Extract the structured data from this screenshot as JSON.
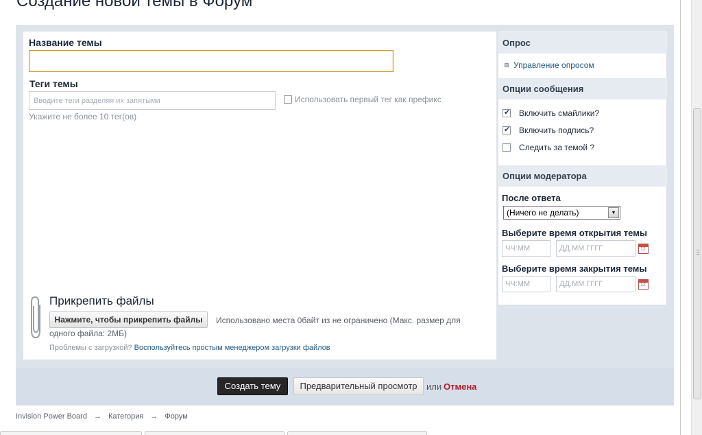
{
  "page": {
    "title": "Создание новой темы в Форум"
  },
  "topic": {
    "title_label": "Название темы",
    "title_value": "",
    "tags_label": "Теги темы",
    "tags_placeholder": "Вводите теги разделяя их запятыми",
    "prefix_label": "Использовать первый тег как префикс",
    "prefix_checked": false,
    "tags_hint": "Укажите не более 10 тег(ов)"
  },
  "attachments": {
    "title": "Прикрепить файлы",
    "button_label": "Нажмите, чтобы прикрепить файлы",
    "usage_text": "Использовано места 0байт из не ограничено (Макс. размер для одного файла: 2МБ)",
    "problem_text": "Проблемы с загрузкой?",
    "basic_uploader_link": "Воспользуйтесь простым менеджером загрузки файлов"
  },
  "sidebar": {
    "poll": {
      "header": "Опрос",
      "manage_link": "Управление опросом"
    },
    "post_options": {
      "header": "Опции сообщения",
      "items": [
        {
          "label": "Включить смайлики?",
          "checked": true
        },
        {
          "label": "Включить подпись?",
          "checked": true
        },
        {
          "label": "Следить за темой ?",
          "checked": false
        }
      ]
    },
    "moderator_options": {
      "header": "Опции модератора",
      "after_reply_label": "После ответа",
      "after_reply_value": "(Ничего не делать)",
      "open_time_label": "Выберите время открытия темы",
      "close_time_label": "Выберите время закрытия темы",
      "time_placeholder": "ЧЧ:ММ",
      "date_placeholder": "ДД.ММ.ГГГГ",
      "calendar_icon_text": "12"
    }
  },
  "actions": {
    "create_label": "Создать тему",
    "preview_label": "Предварительный просмотр",
    "or_text": "или",
    "cancel_label": "Отмена"
  },
  "breadcrumb": {
    "items": [
      "Invision Power Board",
      "Категория",
      "Форум"
    ],
    "separator": "→"
  },
  "colors": {
    "accent_link": "#225985",
    "cancel_red": "#b2202c",
    "panel_bg": "#dde3ea",
    "primary_button": "#272727"
  }
}
